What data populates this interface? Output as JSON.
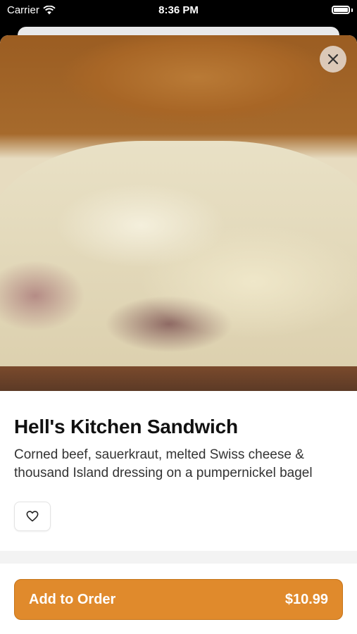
{
  "status_bar": {
    "carrier": "Carrier",
    "time": "8:36 PM"
  },
  "item": {
    "name": "Hell's Kitchen Sandwich",
    "description": "Corned beef, sauerkraut, melted Swiss cheese & thousand Island dressing on a pumpernickel bagel"
  },
  "actions": {
    "add_label": "Add to Order",
    "price": "$10.99"
  },
  "icons": {
    "close": "close-icon",
    "favorite": "heart-outline-icon",
    "wifi": "wifi-icon",
    "battery": "battery-icon"
  },
  "colors": {
    "accent": "#e08a2c"
  }
}
